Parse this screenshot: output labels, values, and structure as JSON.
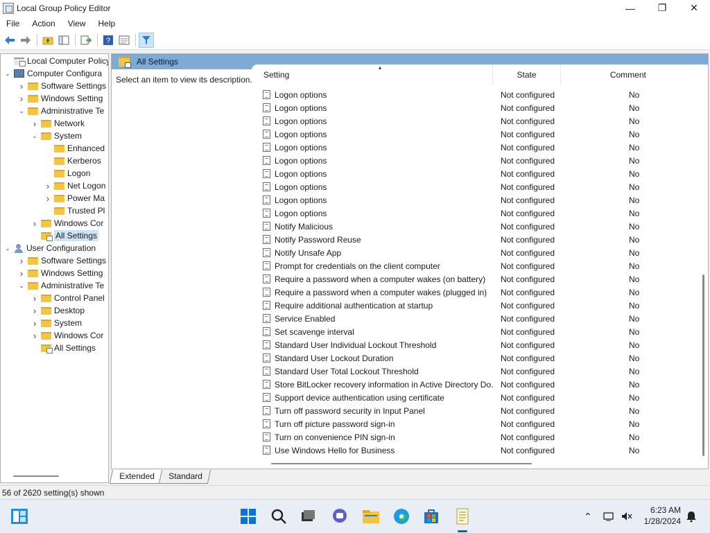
{
  "window": {
    "title": "Local Group Policy Editor",
    "minimize": "—",
    "maximize": "❐",
    "close": "✕"
  },
  "menu": [
    "File",
    "Action",
    "View",
    "Help"
  ],
  "tree": [
    {
      "label": "Local Computer Policy",
      "level": 0,
      "chev": "",
      "icon": "doc",
      "selected": false
    },
    {
      "label": "Computer Configura",
      "level": 0,
      "chev": "down",
      "icon": "pc",
      "selected": false
    },
    {
      "label": "Software Settings",
      "level": 1,
      "chev": "right",
      "icon": "folder",
      "selected": false
    },
    {
      "label": "Windows Setting",
      "level": 1,
      "chev": "right",
      "icon": "folder",
      "selected": false
    },
    {
      "label": "Administrative Te",
      "level": 1,
      "chev": "down",
      "icon": "folder",
      "selected": false
    },
    {
      "label": "Network",
      "level": 2,
      "chev": "right",
      "icon": "folder",
      "selected": false
    },
    {
      "label": "System",
      "level": 2,
      "chev": "down",
      "icon": "folder",
      "selected": false
    },
    {
      "label": "Enhanced",
      "level": 3,
      "chev": "",
      "icon": "folder",
      "selected": false
    },
    {
      "label": "Kerberos",
      "level": 3,
      "chev": "",
      "icon": "folder",
      "selected": false
    },
    {
      "label": "Logon",
      "level": 3,
      "chev": "",
      "icon": "folder",
      "selected": false
    },
    {
      "label": "Net Logon",
      "level": 3,
      "chev": "right",
      "icon": "folder",
      "selected": false
    },
    {
      "label": "Power Ma",
      "level": 3,
      "chev": "right",
      "icon": "folder",
      "selected": false
    },
    {
      "label": "Trusted Pl",
      "level": 3,
      "chev": "",
      "icon": "folder",
      "selected": false
    },
    {
      "label": "Windows Cor",
      "level": 2,
      "chev": "right",
      "icon": "folder",
      "selected": false
    },
    {
      "label": "All Settings",
      "level": 2,
      "chev": "",
      "icon": "special",
      "selected": true
    },
    {
      "label": "User Configuration",
      "level": 0,
      "chev": "down",
      "icon": "user",
      "selected": false
    },
    {
      "label": "Software Settings",
      "level": 1,
      "chev": "right",
      "icon": "folder",
      "selected": false
    },
    {
      "label": "Windows Setting",
      "level": 1,
      "chev": "right",
      "icon": "folder",
      "selected": false
    },
    {
      "label": "Administrative Te",
      "level": 1,
      "chev": "down",
      "icon": "folder",
      "selected": false
    },
    {
      "label": "Control Panel",
      "level": 2,
      "chev": "right",
      "icon": "folder",
      "selected": false
    },
    {
      "label": "Desktop",
      "level": 2,
      "chev": "right",
      "icon": "folder",
      "selected": false
    },
    {
      "label": "System",
      "level": 2,
      "chev": "right",
      "icon": "folder",
      "selected": false
    },
    {
      "label": "Windows Cor",
      "level": 2,
      "chev": "right",
      "icon": "folder",
      "selected": false
    },
    {
      "label": "All Settings",
      "level": 2,
      "chev": "",
      "icon": "special",
      "selected": false
    }
  ],
  "pane": {
    "header": "All Settings",
    "description": "Select an item to view its description."
  },
  "columns": {
    "setting": "Setting",
    "state": "State",
    "comment": "Comment"
  },
  "rows": [
    {
      "setting": "Logon options",
      "state": "Not configured",
      "comment": "No"
    },
    {
      "setting": "Logon options",
      "state": "Not configured",
      "comment": "No"
    },
    {
      "setting": "Logon options",
      "state": "Not configured",
      "comment": "No"
    },
    {
      "setting": "Logon options",
      "state": "Not configured",
      "comment": "No"
    },
    {
      "setting": "Logon options",
      "state": "Not configured",
      "comment": "No"
    },
    {
      "setting": "Logon options",
      "state": "Not configured",
      "comment": "No"
    },
    {
      "setting": "Logon options",
      "state": "Not configured",
      "comment": "No"
    },
    {
      "setting": "Logon options",
      "state": "Not configured",
      "comment": "No"
    },
    {
      "setting": "Logon options",
      "state": "Not configured",
      "comment": "No"
    },
    {
      "setting": "Logon options",
      "state": "Not configured",
      "comment": "No"
    },
    {
      "setting": "Notify Malicious",
      "state": "Not configured",
      "comment": "No"
    },
    {
      "setting": "Notify Password Reuse",
      "state": "Not configured",
      "comment": "No"
    },
    {
      "setting": "Notify Unsafe App",
      "state": "Not configured",
      "comment": "No"
    },
    {
      "setting": "Prompt for credentials on the client computer",
      "state": "Not configured",
      "comment": "No"
    },
    {
      "setting": "Require a password when a computer wakes (on battery)",
      "state": "Not configured",
      "comment": "No"
    },
    {
      "setting": "Require a password when a computer wakes (plugged in)",
      "state": "Not configured",
      "comment": "No"
    },
    {
      "setting": "Require additional authentication at startup",
      "state": "Not configured",
      "comment": "No"
    },
    {
      "setting": "Service Enabled",
      "state": "Not configured",
      "comment": "No"
    },
    {
      "setting": "Set scavenge interval",
      "state": "Not configured",
      "comment": "No"
    },
    {
      "setting": "Standard User Individual Lockout Threshold",
      "state": "Not configured",
      "comment": "No"
    },
    {
      "setting": "Standard User Lockout Duration",
      "state": "Not configured",
      "comment": "No"
    },
    {
      "setting": "Standard User Total Lockout Threshold",
      "state": "Not configured",
      "comment": "No"
    },
    {
      "setting": "Store BitLocker recovery information in Active Directory Do...",
      "state": "Not configured",
      "comment": "No"
    },
    {
      "setting": "Support device authentication using certificate",
      "state": "Not configured",
      "comment": "No"
    },
    {
      "setting": "Turn off password security in Input Panel",
      "state": "Not configured",
      "comment": "No"
    },
    {
      "setting": "Turn off picture password sign-in",
      "state": "Not configured",
      "comment": "No"
    },
    {
      "setting": "Turn on convenience PIN sign-in",
      "state": "Not configured",
      "comment": "No"
    },
    {
      "setting": "Use Windows Hello for Business",
      "state": "Not configured",
      "comment": "No"
    }
  ],
  "tabs": [
    "Extended",
    "Standard"
  ],
  "status": "56 of 2620 setting(s) shown",
  "clock": {
    "time": "6:23 AM",
    "date": "1/28/2024"
  }
}
